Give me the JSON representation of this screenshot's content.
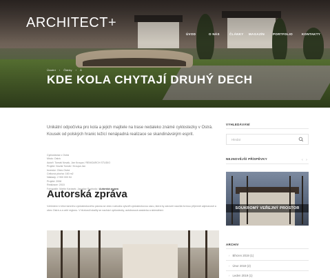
{
  "site": {
    "logo": "ARCHITECT",
    "logo_mark": "+"
  },
  "nav": [
    "ÚVOD",
    "O NÁS",
    "ČLÁNKY",
    "MAGAZÍN",
    "PORTFOLIO",
    "KONTAKTY"
  ],
  "breadcrumb": [
    "Úvodní",
    "Články",
    "Á"
  ],
  "article": {
    "title": "KDE KOLA CHYTAJÍ DRUHÝ DECH",
    "lead": "Unikátní odpočívka pro kola a jejich majitele na trase nedaleko známé cyklostezky v Ostrá. Kousek od polských hranic ležící nenápadná realizace se skandinávským esprit.",
    "meta_lines": [
      "Cyklostezka v Ostrá",
      "Místo: Ostrá",
      "Autoři: Tomáš Novák, Jan Kroupa / REMOARCH STUDIO",
      "Projekt: Novák Tomáš / Kroupa Jan",
      "Investor: Obec Ostrá",
      "Celková plocha: 160 m2",
      "Náklady: 2 900 000 Kč",
      "Projekt: 2008",
      "Realizace: 2015"
    ],
    "meta_photo_label": "Fotografie: Martin Karásek; Jaroslav Svoboda /",
    "meta_photo_bold": "Autorská zpráva",
    "section_title": "Autorská zpráva",
    "section_body": "Vzhledem k šířce tamního cyklostezkového pásma se obec rozhodla vytvořit cyklostezkovou oázu, která by zároveň naučila formou příjemně zajímavosti a obec Ostrá a a celé regionu. V blízkosti lokality se nachází cyklostezky, autobusová zastávka a sklenářství."
  },
  "sidebar": {
    "search_heading": "VYHLEDÁVÁNÍ",
    "search_placeholder": "Hledat",
    "popular_heading": "NEJNOVĚJŠÍ PŘÍSPĚVKY",
    "prev_arrow": "‹",
    "next_arrow": "›",
    "featured_caption": "SOUKROMÝ VEŘEJNÝ PROSTOR",
    "archive_heading": "ARCHIV",
    "archive_items": [
      "Březen 2019 (1)",
      "Únor 2019 (2)",
      "Leden 2019 (1)"
    ]
  }
}
